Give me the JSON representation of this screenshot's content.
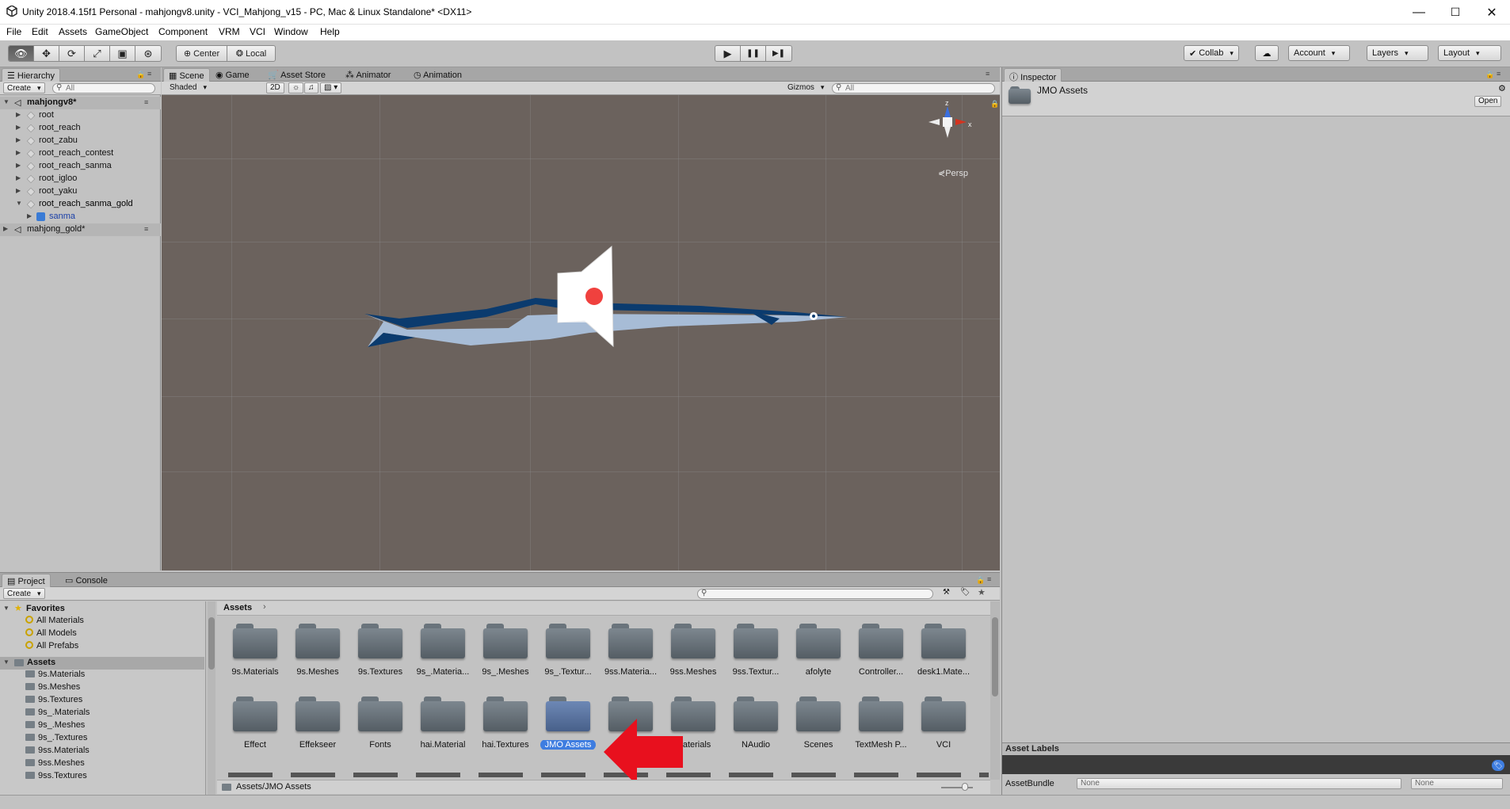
{
  "window": {
    "title": "Unity 2018.4.15f1 Personal - mahjongv8.unity - VCI_Mahjong_v15 - PC, Mac & Linux Standalone* <DX11>",
    "minimize": "—",
    "maximize": "☐",
    "close": "✕"
  },
  "menu": [
    "File",
    "Edit",
    "Assets",
    "GameObject",
    "Component",
    "VRM",
    "VCI",
    "Window",
    "Help"
  ],
  "toolbar": {
    "pivot": "Center",
    "space": "Local",
    "play": "▶",
    "pause": "❚❚",
    "step": "▶❚",
    "collab": "Collab",
    "account": "Account",
    "layers": "Layers",
    "layout": "Layout"
  },
  "hierarchy": {
    "tab": "Hierarchy",
    "create": "Create",
    "search_placeholder": "All",
    "scene1": "mahjongv8*",
    "items": [
      "root",
      "root_reach",
      "root_zabu",
      "root_reach_contest",
      "root_reach_sanma",
      "root_igloo",
      "root_yaku",
      "root_reach_sanma_gold"
    ],
    "child": "sanma",
    "scene2": "mahjong_gold*"
  },
  "scene": {
    "tabs": [
      "Scene",
      "Game",
      "Asset Store",
      "Animator",
      "Animation"
    ],
    "shading": "Shaded",
    "mode2d": "2D",
    "gizmos": "Gizmos",
    "search_placeholder": "All",
    "persp": "Persp",
    "axis_z": "z",
    "axis_x": "x"
  },
  "inspector": {
    "tab": "Inspector",
    "asset_name": "JMO Assets",
    "open": "Open",
    "labels_header": "Asset Labels",
    "assetbundle_label": "AssetBundle",
    "assetbundle_value": "None",
    "variant_value": "None"
  },
  "project": {
    "tabs": [
      "Project",
      "Console"
    ],
    "create": "Create",
    "favorites_label": "Favorites",
    "favorites": [
      "All Materials",
      "All Models",
      "All Prefabs"
    ],
    "assets_label": "Assets",
    "tree": [
      "9s.Materials",
      "9s.Meshes",
      "9s.Textures",
      "9s_.Materials",
      "9s_.Meshes",
      "9s_.Textures",
      "9ss.Materials",
      "9ss.Meshes",
      "9ss.Textures"
    ],
    "breadcrumb": "Assets",
    "grid_row1": [
      "9s.Materials",
      "9s.Meshes",
      "9s.Textures",
      "9s_.Materia...",
      "9s_.Meshes",
      "9s_.Textur...",
      "9ss.Materia...",
      "9ss.Meshes",
      "9ss.Textur...",
      "afolyte",
      "Controller...",
      "desk1.Mate..."
    ],
    "grid_row2": [
      "Effect",
      "Effekseer",
      "Fonts",
      "hai.Material",
      "hai.Textures",
      "JMO Assets",
      "mahj...",
      "Materials",
      "NAudio",
      "Scenes",
      "TextMesh P...",
      "VCI"
    ],
    "selected_path": "Assets/JMO Assets"
  },
  "colors": {
    "scene_bg": "#6b625d",
    "fish_light": "#a7bcd6",
    "fish_dark": "#0b3b6e",
    "arrow_red": "#e8101e",
    "selection_blue": "#3e7de0"
  }
}
